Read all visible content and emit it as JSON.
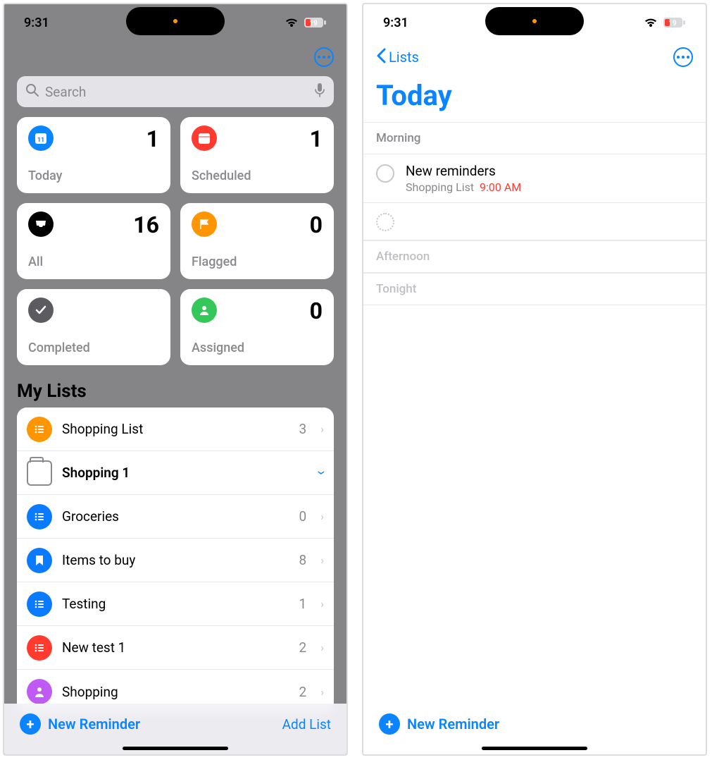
{
  "status": {
    "time": "9:31",
    "battery_level": "19"
  },
  "left": {
    "search_placeholder": "Search",
    "smart": {
      "today": {
        "label": "Today",
        "count": "1"
      },
      "scheduled": {
        "label": "Scheduled",
        "count": "1"
      },
      "all": {
        "label": "All",
        "count": "16"
      },
      "flagged": {
        "label": "Flagged",
        "count": "0"
      },
      "completed": {
        "label": "Completed"
      },
      "assigned": {
        "label": "Assigned",
        "count": "0"
      }
    },
    "my_lists_header": "My Lists",
    "lists": {
      "shopping_list": {
        "title": "Shopping List",
        "count": "3"
      },
      "shopping1": {
        "title": "Shopping 1"
      },
      "groceries": {
        "title": "Groceries",
        "count": "0"
      },
      "items_to_buy": {
        "title": "Items to buy",
        "count": "8"
      },
      "testing": {
        "title": "Testing",
        "count": "1"
      },
      "new_test_1": {
        "title": "New test 1",
        "count": "2"
      },
      "shopping": {
        "title": "Shopping",
        "count": "2"
      }
    },
    "new_reminder_label": "New Reminder",
    "add_list_label": "Add List"
  },
  "right": {
    "back_label": "Lists",
    "title": "Today",
    "sections": {
      "morning": "Morning",
      "afternoon": "Afternoon",
      "tonight": "Tonight"
    },
    "reminder": {
      "title": "New reminders",
      "list": "Shopping List",
      "time": "9:00 AM"
    },
    "new_reminder_label": "New Reminder"
  }
}
